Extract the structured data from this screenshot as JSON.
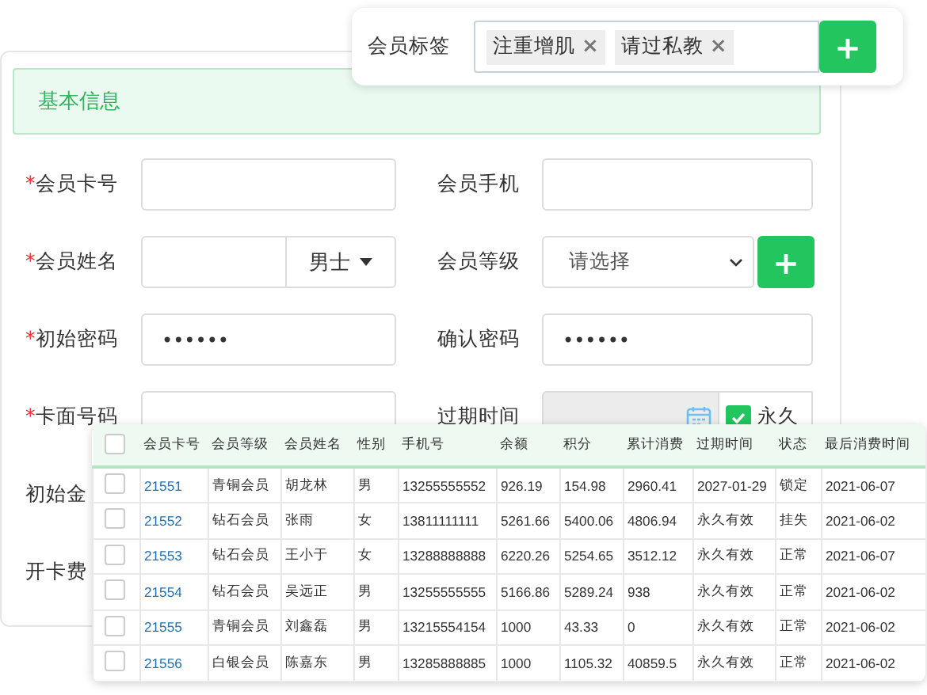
{
  "tag_panel": {
    "label": "会员标签",
    "tags": [
      "注重增肌",
      "请过私教"
    ],
    "remove_glyph": "×",
    "add_glyph": "+"
  },
  "section_title": "基本信息",
  "form_rows": [
    {
      "left": {
        "required_mark": "*",
        "label": "会员卡号",
        "kind": "text"
      },
      "right": {
        "label": "会员手机",
        "kind": "text"
      }
    },
    {
      "left": {
        "required_mark": "*",
        "label": "会员姓名",
        "kind": "name_gender",
        "option": "男士"
      },
      "right": {
        "label": "会员等级",
        "kind": "select_add",
        "placeholder": "请选择",
        "add_glyph": "+"
      }
    },
    {
      "left": {
        "required_mark": "*",
        "label": "初始密码",
        "kind": "password",
        "value": "••••••"
      },
      "right": {
        "label": "确认密码",
        "kind": "password",
        "value": "••••••"
      }
    },
    {
      "left": {
        "required_mark": "*",
        "label": "卡面号码",
        "kind": "text"
      },
      "right": {
        "label": "过期时间",
        "kind": "date_permanent",
        "disabled": true,
        "checkbox_label": "永久",
        "checked": true
      }
    },
    {
      "left": {
        "label": "初始金",
        "kind": "label_only"
      }
    },
    {
      "left": {
        "label": "开卡费",
        "kind": "label_only"
      }
    }
  ],
  "table": {
    "header_checked": false,
    "columns": [
      "会员卡号",
      "会员等级",
      "会员姓名",
      "性别",
      "手机号",
      "余额",
      "积分",
      "累计消费",
      "过期时间",
      "状态",
      "最后消费时间"
    ],
    "rows": [
      {
        "checked": false,
        "cells": [
          "21551",
          "青铜会员",
          "胡龙林",
          "男",
          "13255555552",
          "926.19",
          "154.98",
          "2960.41",
          "2027-01-29",
          "锁定",
          "2021-06-07"
        ]
      },
      {
        "checked": false,
        "cells": [
          "21552",
          "钻石会员",
          "张雨",
          "女",
          "13811111111",
          "5261.66",
          "5400.06",
          "4806.94",
          "永久有效",
          "挂失",
          "2021-06-02"
        ]
      },
      {
        "checked": false,
        "cells": [
          "21553",
          "钻石会员",
          "王小于",
          "女",
          "13288888888",
          "6220.26",
          "5254.65",
          "3512.12",
          "永久有效",
          "正常",
          "2021-06-07"
        ]
      },
      {
        "checked": false,
        "cells": [
          "21554",
          "钻石会员",
          "吴远正",
          "男",
          "13255555555",
          "5166.86",
          "5289.24",
          "938",
          "永久有效",
          "正常",
          "2021-06-02"
        ]
      },
      {
        "checked": false,
        "cells": [
          "21555",
          "青铜会员",
          "刘鑫磊",
          "男",
          "13215554154",
          "1000",
          "43.33",
          "0",
          "永久有效",
          "正常",
          "2021-06-02"
        ]
      },
      {
        "checked": false,
        "cells": [
          "21556",
          "白银会员",
          "陈嘉东",
          "男",
          "13285888885",
          "1000",
          "1105.32",
          "40859.5",
          "永久有效",
          "正常",
          "2021-06-02"
        ]
      }
    ]
  }
}
